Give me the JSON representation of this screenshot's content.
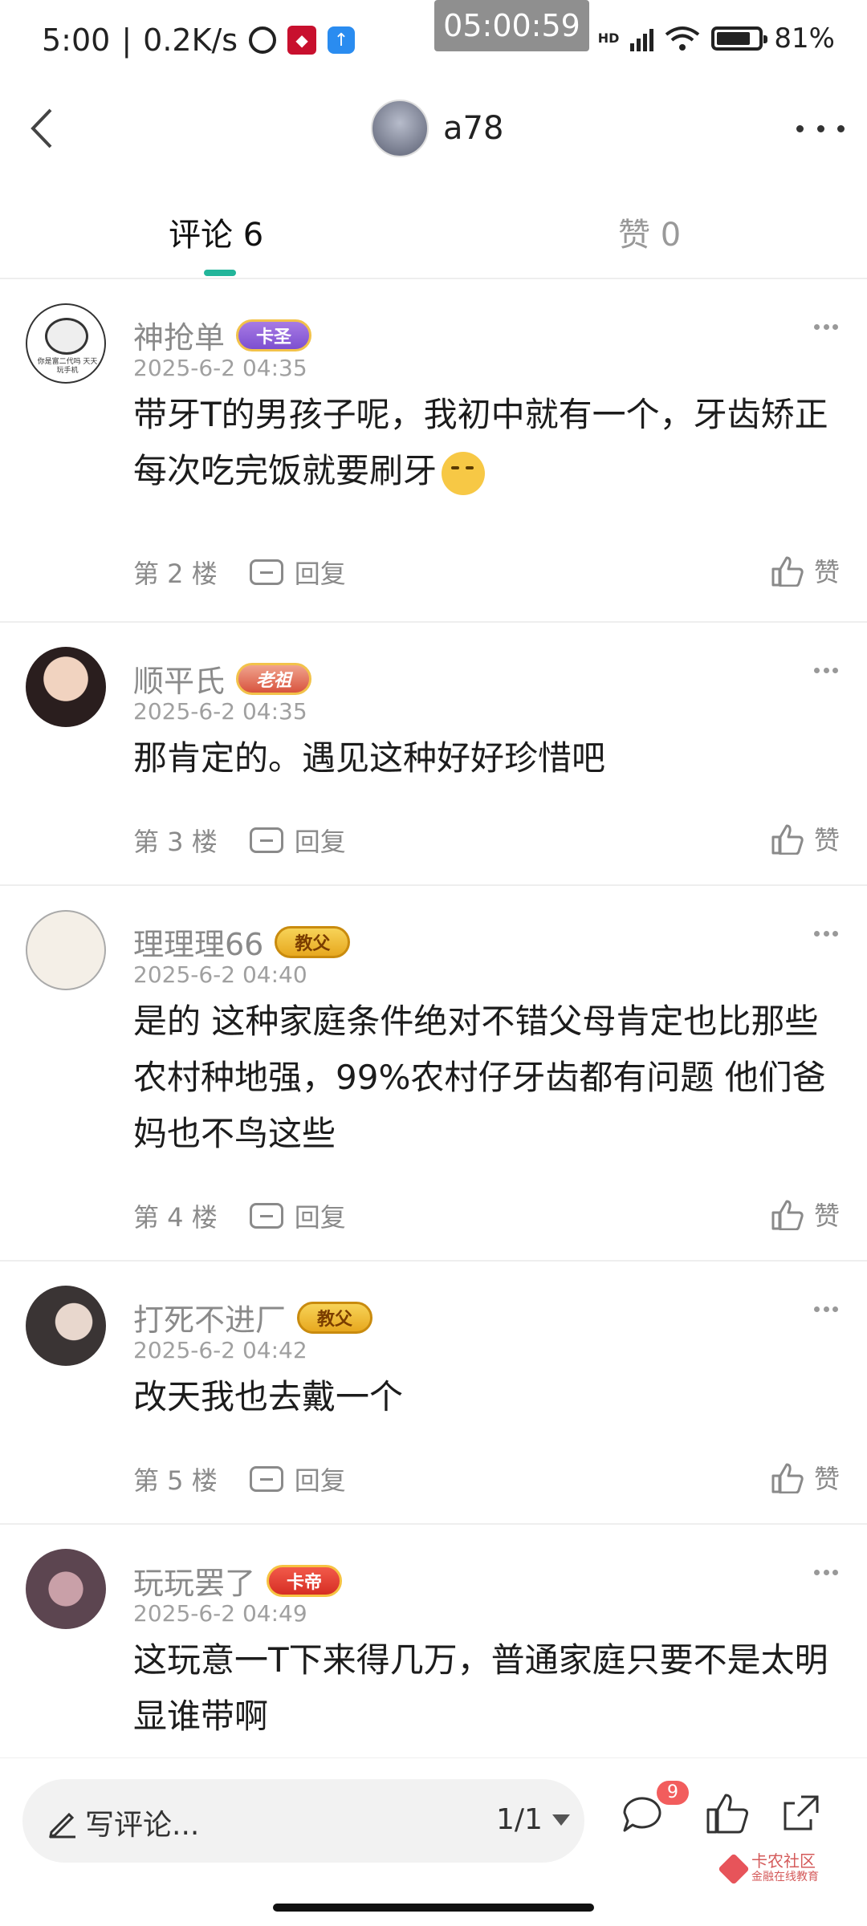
{
  "status_bar": {
    "time": "5:00",
    "speed": "0.2K/s",
    "clock_overlay": "05:00:59",
    "network_label": "HD",
    "battery": "81%",
    "battery_level": 0.81
  },
  "nav": {
    "username": "a78"
  },
  "tabs": [
    {
      "label": "评论 6",
      "active": true
    },
    {
      "label": "赞 0",
      "active": false
    }
  ],
  "comments": [
    {
      "user": "神抢单",
      "badge": "卡圣",
      "time": "2025-6-2 04:35",
      "text": "带牙T的男孩子呢，我初中就有一个，牙齿矫正每次吃完饭就要刷牙",
      "floor": "第 2 楼",
      "reply": "回复",
      "like": "赞",
      "avatar_caption": "你是富二代吗 天天玩手机"
    },
    {
      "user": "顺平氏",
      "badge": "老祖",
      "time": "2025-6-2 04:35",
      "text": "那肯定的。遇见这种好好珍惜吧",
      "floor": "第 3 楼",
      "reply": "回复",
      "like": "赞"
    },
    {
      "user": "理理理66",
      "badge": "教父",
      "time": "2025-6-2 04:40",
      "text": "是的 这种家庭条件绝对不错父母肯定也比那些农村种地强，99%农村仔牙齿都有问题 他们爸妈也不鸟这些",
      "floor": "第 4 楼",
      "reply": "回复",
      "like": "赞"
    },
    {
      "user": "打死不进厂",
      "badge": "教父",
      "time": "2025-6-2 04:42",
      "text": "改天我也去戴一个",
      "floor": "第 5 楼",
      "reply": "回复",
      "like": "赞"
    },
    {
      "user": "玩玩罢了",
      "badge": "卡帝",
      "time": "2025-6-2 04:49",
      "text": "这玩意一T下来得几万，普通家庭只要不是太明显谁带啊",
      "floor": "",
      "reply": "",
      "like": ""
    }
  ],
  "bottom_bar": {
    "input_placeholder": "写评论...",
    "pages": "1/1",
    "notification_count": "9",
    "watermark_line1": "卡农社区",
    "watermark_line2": "金融在线教育"
  },
  "colors": {
    "accent": "#22b59a",
    "badge_notification": "#f25d5d"
  }
}
